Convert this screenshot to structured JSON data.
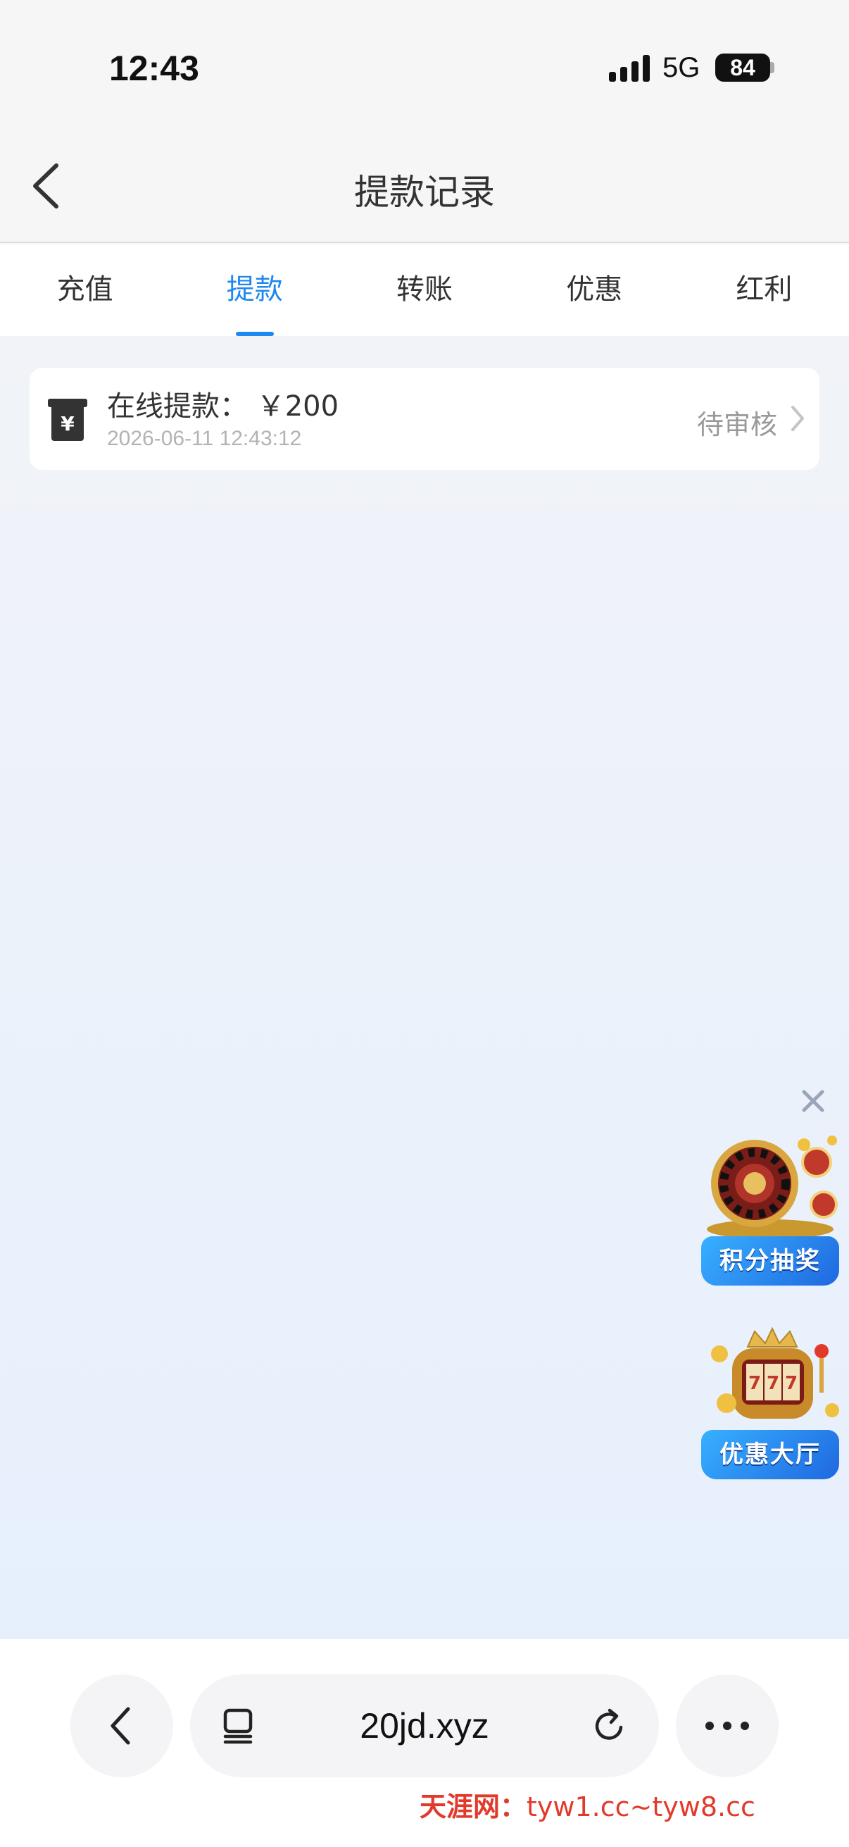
{
  "status_bar": {
    "time": "12:43",
    "network": "5G",
    "battery": "84"
  },
  "header": {
    "title": "提款记录"
  },
  "tabs": [
    {
      "label": "充值",
      "active": false
    },
    {
      "label": "提款",
      "active": true
    },
    {
      "label": "转账",
      "active": false
    },
    {
      "label": "优惠",
      "active": false
    },
    {
      "label": "红利",
      "active": false
    }
  ],
  "records": [
    {
      "title": "在线提款： ￥200",
      "time": "2026-06-11 12:43:12",
      "status": "待审核"
    }
  ],
  "promos": {
    "lottery_label": "积分抽奖",
    "offers_label": "优惠大厅"
  },
  "browser": {
    "url": "20jd.xyz"
  },
  "watermark": {
    "site": "天涯网：",
    "domains": "tyw1.cc~tyw8.cc"
  },
  "colors": {
    "accent": "#1e88f0",
    "promo_blue": "#2a8ef5"
  }
}
